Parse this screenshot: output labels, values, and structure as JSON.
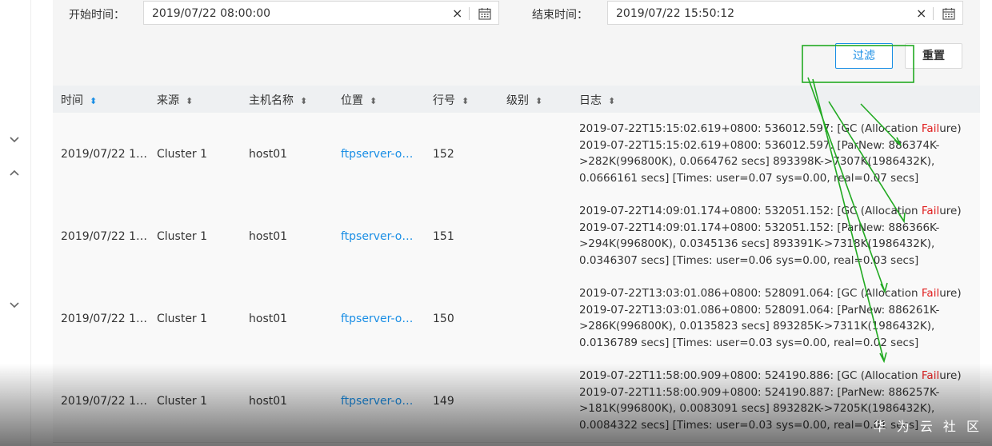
{
  "filter": {
    "start_label": "开始时间：",
    "start_value": "2019/07/22 08:00:00",
    "end_label": "结束时间：",
    "end_value": "2019/07/22 15:50:12",
    "clear_glyph": "×",
    "filter_button": "过滤",
    "reset_button": "重置"
  },
  "table": {
    "columns": [
      {
        "label": "时间",
        "sort": "active"
      },
      {
        "label": "来源",
        "sort": "none"
      },
      {
        "label": "主机名称",
        "sort": "none"
      },
      {
        "label": "位置",
        "sort": "none"
      },
      {
        "label": "行号",
        "sort": "none"
      },
      {
        "label": "级别",
        "sort": "none"
      },
      {
        "label": "日志",
        "sort": "none"
      }
    ],
    "rows": [
      {
        "time": "2019/07/22 1…",
        "source": "Cluster 1",
        "host": "host01",
        "location": "ftpserver-o…",
        "line": "152",
        "level": "",
        "log": {
          "l1_pre": "2019-07-22T15:15:02.619+0800: 536012.597: [GC (Allocation ",
          "fail": "Fail",
          "l1_post": "ure)",
          "l2": "2019-07-22T15:15:02.619+0800: 536012.597: [ParNew: 886374K-",
          "l3": ">282K(996800K), 0.0664762 secs] 893398K->7307K(1986432K),",
          "l4": "0.0666161 secs] [Times: user=0.07 sys=0.00, real=0.07 secs]"
        }
      },
      {
        "time": "2019/07/22 1…",
        "source": "Cluster 1",
        "host": "host01",
        "location": "ftpserver-o…",
        "line": "151",
        "level": "",
        "log": {
          "l1_pre": "2019-07-22T14:09:01.174+0800: 532051.152: [GC (Allocation ",
          "fail": "Fail",
          "l1_post": "ure)",
          "l2": "2019-07-22T14:09:01.174+0800: 532051.152: [ParNew: 886366K-",
          "l3": ">294K(996800K), 0.0345136 secs] 893391K->7318K(1986432K),",
          "l4": "0.0346307 secs] [Times: user=0.06 sys=0.00, real=0.03 secs]"
        }
      },
      {
        "time": "2019/07/22 1…",
        "source": "Cluster 1",
        "host": "host01",
        "location": "ftpserver-o…",
        "line": "150",
        "level": "",
        "log": {
          "l1_pre": "2019-07-22T13:03:01.086+0800: 528091.064: [GC (Allocation ",
          "fail": "Fail",
          "l1_post": "ure)",
          "l2": "2019-07-22T13:03:01.086+0800: 528091.064: [ParNew: 886261K-",
          "l3": ">286K(996800K), 0.0135823 secs] 893285K->7311K(1986432K),",
          "l4": "0.0136789 secs] [Times: user=0.03 sys=0.00, real=0.02 secs]"
        }
      },
      {
        "time": "2019/07/22 1…",
        "source": "Cluster 1",
        "host": "host01",
        "location": "ftpserver-o…",
        "line": "149",
        "level": "",
        "log": {
          "l1_pre": "2019-07-22T11:58:00.909+0800: 524190.886: [GC (Allocation ",
          "fail": "Fail",
          "l1_post": "ure)",
          "l2": "2019-07-22T11:58:00.909+0800: 524190.887: [ParNew: 886257K-",
          "l3": ">181K(996800K), 0.0083091 secs] 893282K->7205K(1986432K),",
          "l4": "0.0084322 secs] [Times: user=0.03 sys=0.00, real=0.01 secs]"
        }
      }
    ]
  },
  "watermark": "华 为 云 社 区",
  "colors": {
    "accent": "#1a8ee5",
    "failure": "#e02020",
    "annotation": "#22aa22"
  },
  "icons": [
    "chevron-down-icon",
    "chevron-up-icon",
    "clear-icon",
    "calendar-icon",
    "sort-icon"
  ]
}
